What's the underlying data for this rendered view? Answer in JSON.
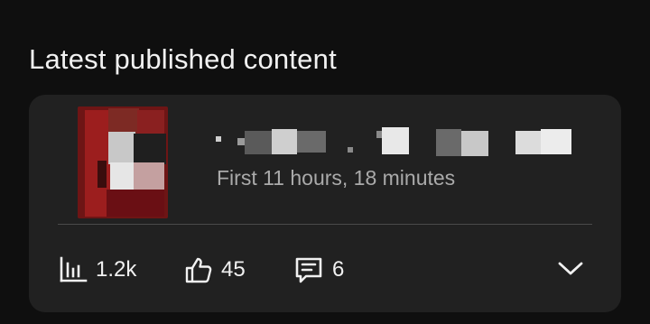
{
  "section": {
    "title": "Latest published content"
  },
  "video": {
    "meta": "First 11 hours, 18 minutes",
    "thumbnail_colors": [
      "#8b1a1a",
      "#5a1212",
      "#c9c9c9",
      "#2a2a2a",
      "#7a3030"
    ]
  },
  "stats": {
    "views": {
      "icon": "bar-chart-icon",
      "value": "1.2k"
    },
    "likes": {
      "icon": "thumbs-up-icon",
      "value": "45"
    },
    "comments": {
      "icon": "comment-icon",
      "value": "6"
    }
  },
  "expand": {
    "icon": "chevron-down-icon"
  },
  "colors": {
    "background": "#0f0f0f",
    "card": "#212121",
    "text_primary": "#f1f1f1",
    "text_secondary": "#aaaaaa",
    "divider": "#4a4a4a"
  }
}
